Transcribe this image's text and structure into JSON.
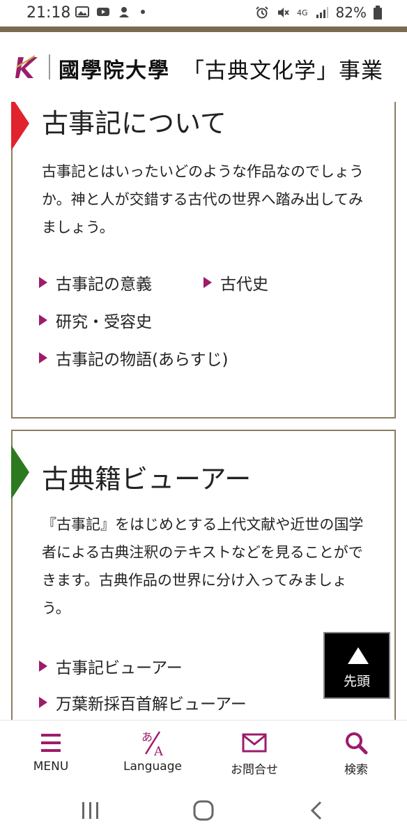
{
  "status_bar": {
    "time": "21:18",
    "battery": "82%",
    "network": "4G"
  },
  "header": {
    "university_name": "國學院大學",
    "project_name": "「古典文化学」事業"
  },
  "cards": [
    {
      "title": "古事記について",
      "flag_color": "#e0232d",
      "description": "古事記とはいったいどのような作品なのでしょうか。神と人が交錯する古代の世界へ踏み出してみましょう。",
      "links": [
        "古事記の意義",
        "古代史",
        "研究・受容史",
        "古事記の物語(あらすじ)"
      ]
    },
    {
      "title": "古典籍ビューアー",
      "flag_color": "#2d7a1e",
      "description": "『古事記』をはじめとする上代文献や近世の国学者による古典注釈のテキストなどを見ることができます。古典作品の世界に分け入ってみましょう。",
      "links": [
        "古事記ビューアー",
        "万葉新採百首解ビューアー"
      ]
    }
  ],
  "back_to_top": {
    "label": "先頭"
  },
  "bottom_nav": {
    "menu": "MENU",
    "language": "Language",
    "contact": "お問合せ",
    "search": "検索"
  },
  "colors": {
    "accent": "#9c1c6b",
    "border": "#8b7d63",
    "header_rule": "#7a6a4f"
  }
}
